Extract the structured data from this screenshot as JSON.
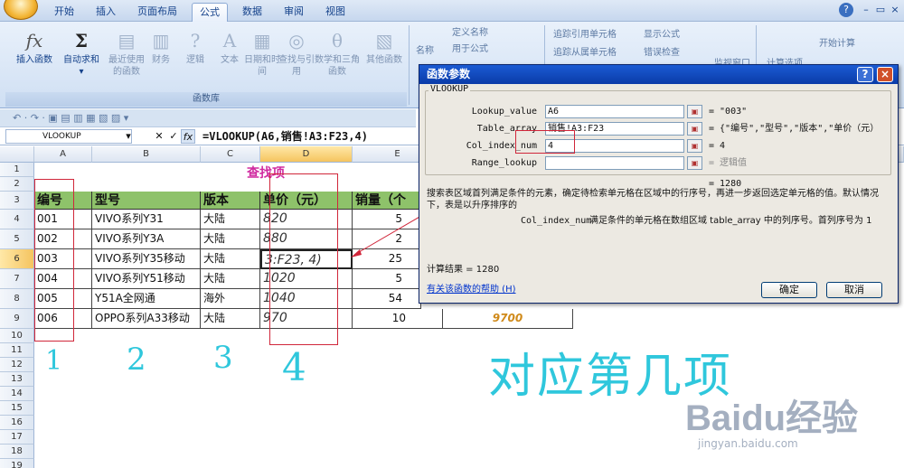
{
  "ribbon_tabs": [
    "开始",
    "插入",
    "页面布局",
    "公式",
    "数据",
    "审阅",
    "视图"
  ],
  "active_tab": "公式",
  "window_controls": [
    "?",
    "–",
    "▭",
    "×"
  ],
  "ribbon": {
    "buttons": [
      {
        "icon": "fx",
        "label": "插入函数"
      },
      {
        "icon": "Σ",
        "label": "自动求和"
      },
      {
        "icon": "▤",
        "label": "最近使用的函数"
      },
      {
        "icon": "▥",
        "label": "财务"
      },
      {
        "icon": "?",
        "label": "逻辑"
      },
      {
        "icon": "A",
        "label": "文本"
      },
      {
        "icon": "▦",
        "label": "日期和时间"
      },
      {
        "icon": "◎",
        "label": "查找与引用"
      },
      {
        "icon": "θ",
        "label": "数学和三角函数"
      },
      {
        "icon": "▧",
        "label": "其他函数"
      }
    ],
    "group_label": "函数库",
    "defined_names": [
      "定义名称",
      "用于公式"
    ],
    "defined_names_group": "名称",
    "audit_items": [
      "追踪引用单元格",
      "追踪从属单元格",
      "显示公式",
      "错误检查"
    ],
    "watch_label": "监视窗口",
    "calc_label": "开始计算",
    "calc_options": "计算选项"
  },
  "namebox": "VLOOKUP",
  "fx_symbols": {
    "cancel": "✕",
    "confirm": "✓",
    "fx": "fx"
  },
  "formula": "=VLOOKUP(A6,销售!A3:F23,4)",
  "columns": [
    "A",
    "B",
    "C",
    "D",
    "E"
  ],
  "rows": [
    "1",
    "2",
    "3",
    "4",
    "5",
    "6",
    "7",
    "8",
    "9",
    "10",
    "11",
    "12",
    "13",
    "14",
    "15",
    "16",
    "17",
    "18",
    "19"
  ],
  "lookup_title": "查找项",
  "table": {
    "headers": [
      "编号",
      "型号",
      "版本",
      "单价（元）",
      "销量（个"
    ],
    "rows": [
      [
        "001",
        "VIVO系列Y31",
        "大陆",
        "820",
        "5"
      ],
      [
        "002",
        "VIVO系列Y3A",
        "大陆",
        "880",
        "2"
      ],
      [
        "003",
        "VIVO系列Y35移动",
        "大陆",
        "3:F23, 4)",
        "25"
      ],
      [
        "004",
        "VIVO系列Y51移动",
        "大陆",
        "1020",
        "5"
      ],
      [
        "005",
        "Y51A全网通",
        "海外",
        "1040",
        "54"
      ],
      [
        "006",
        "OPPO系列A33移动",
        "大陆",
        "970",
        "10"
      ]
    ],
    "extra_value": "9700"
  },
  "dialog": {
    "title": "函数参数",
    "function": "VLOOKUP",
    "params": [
      {
        "name": "Lookup_value",
        "value": "A6",
        "result": "= \"003\""
      },
      {
        "name": "Table_array",
        "value": "销售!A3:F23",
        "result": "= {\"编号\",\"型号\",\"版本\",\"单价（元）"
      },
      {
        "name": "Col_index_num",
        "value": "4",
        "result": "= 4"
      },
      {
        "name": "Range_lookup",
        "value": "",
        "result": "= 逻辑值"
      }
    ],
    "overall_result": "= 1280",
    "description": "搜索表区域首列满足条件的元素，确定待检索单元格在区域中的行序号，再进一步返回选定单元格的值。默认情况下，表是以升序排序的",
    "param_help_name": "Col_index_num",
    "param_help_text": "满足条件的单元格在数组区域 table_array 中的列序号。首列序号为 1",
    "calc_result": "计算结果 = 1280",
    "help_link": "有关该函数的帮助 (H)",
    "ok": "确定",
    "cancel": "取消",
    "help_btn": "?",
    "close_btn": "×"
  },
  "annotations": {
    "numbers": [
      "1",
      "2",
      "3",
      "4"
    ],
    "phrase": "对应第几项"
  },
  "watermark": {
    "brand": "Baidu经验",
    "url": "jingyan.baidu.com"
  }
}
